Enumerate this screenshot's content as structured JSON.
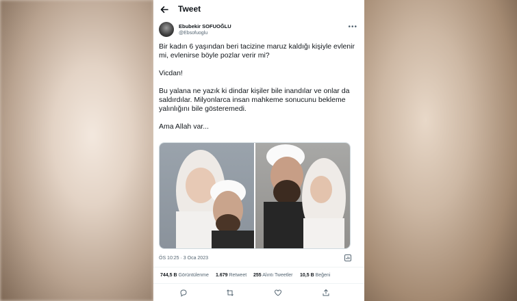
{
  "header": {
    "title": "Tweet",
    "back_icon": "back-arrow-icon"
  },
  "author": {
    "name": "Ebubekir SOFUOĞLU",
    "handle": "@Ebsofuoglu",
    "more_icon": "more-dots-icon"
  },
  "tweet": {
    "text": "Bir kadın 6 yaşından beri tacizine maruz kaldığı kişiyle evlenir mi, evlenirse böyle pozlar verir mi?\n\nVicdan!\n\nBu yalana ne yazık ki dindar kişiler bile inandılar ve onlar da saldırdılar. Milyonlarca insan mahkeme sonucunu bekleme yalınlığını bile gösteremedi.\n\nAma Allah var..."
  },
  "meta": {
    "timestamp": "ÖS 10:25 · 3 Oca 2023"
  },
  "stats": [
    {
      "value": "744,5 B",
      "label": "Görüntülenme"
    },
    {
      "value": "1.679",
      "label": "Retweet"
    },
    {
      "value": "255",
      "label": "Alıntı Tweetler"
    },
    {
      "value": "10,5 B",
      "label": "Beğeni"
    }
  ],
  "actions": [
    "reply-icon",
    "retweet-icon",
    "like-icon",
    "share-icon"
  ],
  "colors": {
    "text": "#0f1419",
    "secondary": "#536471",
    "divider": "#eff3f4"
  }
}
